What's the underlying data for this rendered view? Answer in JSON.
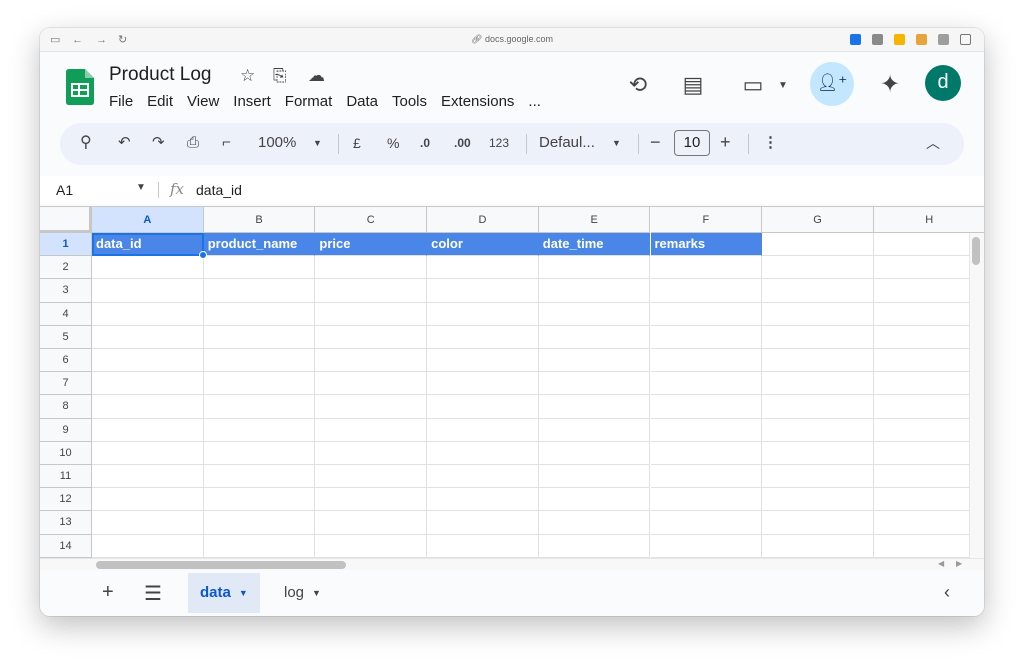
{
  "browser": {
    "url": "docs.google.com"
  },
  "header": {
    "doc_title": "Product Log",
    "avatar_letter": "d",
    "menu": [
      "File",
      "Edit",
      "View",
      "Insert",
      "Format",
      "Data",
      "Tools",
      "Extensions",
      "..."
    ]
  },
  "toolbar": {
    "zoom": "100%",
    "currency": "£",
    "percent": "%",
    "decrease_decimal": ".0",
    "increase_decimal": ".00",
    "number_format": "123",
    "font": "Defaul...",
    "font_size": "10",
    "minus": "−",
    "plus": "+"
  },
  "formula_bar": {
    "name_box": "A1",
    "fx": "fx",
    "value": "data_id"
  },
  "grid": {
    "columns": [
      "A",
      "B",
      "C",
      "D",
      "E",
      "F",
      "G",
      "H"
    ],
    "rows": [
      "1",
      "2",
      "3",
      "4",
      "5",
      "6",
      "7",
      "8",
      "9",
      "10",
      "11",
      "12",
      "13",
      "14"
    ],
    "header_row": [
      "data_id",
      "product_name",
      "price",
      "color",
      "date_time",
      "remarks"
    ],
    "header_color": "#4a86e8",
    "selected_cell": "A1"
  },
  "sheets": {
    "tabs": [
      "data",
      "log"
    ],
    "active": "data"
  }
}
